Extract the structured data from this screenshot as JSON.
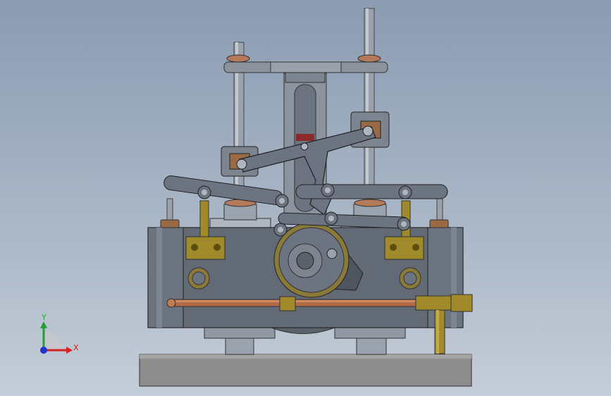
{
  "triad": {
    "x_label": "X",
    "y_label": "Y",
    "x_color": "#d42020",
    "y_color": "#22a033",
    "z_color": "#2233cc"
  },
  "colors": {
    "background_top": "#8b9bb2",
    "background_bottom": "#c5cdd8",
    "steel": "#6b7480",
    "steel_light": "#9aa3ad",
    "brass": "#a08a2a",
    "copper": "#b06a45",
    "base": "#8e8e8e"
  }
}
